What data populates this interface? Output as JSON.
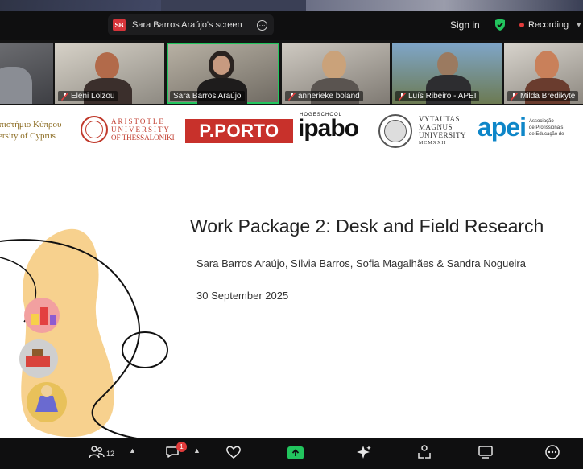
{
  "topbar": {
    "share_badge": "SB",
    "share_label": "Sara Barros Araújo's screen",
    "sign_in": "Sign in",
    "recording": "Recording"
  },
  "participants": [
    {
      "name": "Eleni Loizou",
      "muted": true
    },
    {
      "name": "Sara Barros Araújo",
      "muted": false,
      "active": true
    },
    {
      "name": "annerieke boland",
      "muted": true
    },
    {
      "name": "Luís Ribeiro - APEI",
      "muted": true
    },
    {
      "name": "Milda Brėdikytė",
      "muted": true
    }
  ],
  "slide": {
    "logos": {
      "cyprus_line1": "Πανεπιστήμιο Κύπρου",
      "cyprus_line2": "University of Cyprus",
      "auth_line1": "ARISTOTLE",
      "auth_line2": "UNIVERSITY",
      "auth_line3": "OF THESSALONIKI",
      "porto": "P.PORTO",
      "ipabo_small": "HOGESCHOOL",
      "ipabo": "ipabo",
      "vmu_line1": "VYTAUTAS",
      "vmu_line2": "MAGNUS",
      "vmu_line3": "UNIVERSITY",
      "vmu_line4": "MCMXXII",
      "apei": "apei",
      "apei_line1": "Associação",
      "apei_line2": "de Profissionais",
      "apei_line3": "de Educação de"
    },
    "title": "Work Package 2: Desk and Field Research",
    "authors": "Sara Barros Araújo, Sílvia Barros, Sofia Magalhães & Sandra Nogueira",
    "date": "30 September 2025"
  },
  "toolbar": {
    "participants_count": "12",
    "chat_badge": "1"
  },
  "colors": {
    "active_speaker": "#22c55e",
    "recording": "#e23b3b",
    "porto_red": "#c8312b",
    "apei_blue": "#0e86c8"
  }
}
